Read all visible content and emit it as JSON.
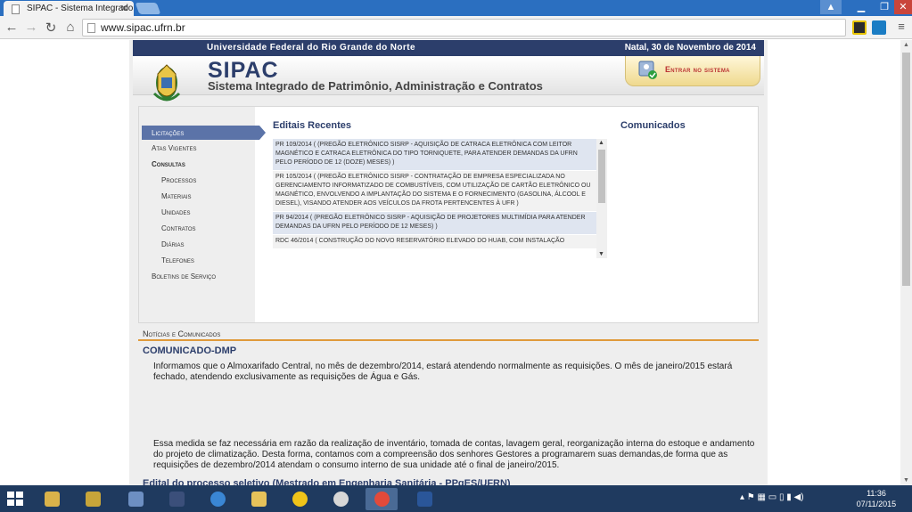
{
  "browser": {
    "tab_title": "SIPAC - Sistema Integrado",
    "url": "www.sipac.ufrn.br"
  },
  "site": {
    "university": "Universidade Federal do Rio Grande do Norte",
    "date": "Natal, 30 de Novembro de 2014",
    "title": "SIPAC",
    "subtitle": "Sistema Integrado de Patrimônio, Administração e Contratos",
    "login_label": "Entrar no sistema"
  },
  "menu": {
    "items": [
      {
        "label": "Licitações"
      },
      {
        "label": "Atas Vigentes"
      },
      {
        "label": "Consultas"
      },
      {
        "label": "Processos"
      },
      {
        "label": "Materiais"
      },
      {
        "label": "Unidades"
      },
      {
        "label": "Contratos"
      },
      {
        "label": "Diárias"
      },
      {
        "label": "Telefones"
      },
      {
        "label": "Boletins de Serviço"
      }
    ]
  },
  "editais": {
    "title": "Editais Recentes",
    "items": [
      {
        "text": "PR 109/2014 ( (PREGÃO ELETRÔNICO SISRP - AQUISIÇÃO DE CATRACA ELETRÔNICA COM LEITOR MAGNÉTICO E CATRACA ELETRÔNICA DO TIPO TORNIQUETE, PARA ATENDER DEMANDAS DA UFRN PELO PERÍODO DE 12 (DOZE) MESES) )"
      },
      {
        "text": "PR 105/2014 ( (PREGÃO ELETRÔNICO SISRP - CONTRATAÇÃO DE EMPRESA ESPECIALIZADA NO GERENCIAMENTO INFORMATIZADO DE COMBUSTÍVEIS, COM UTILIZAÇÃO DE CARTÃO ELETRÔNICO OU MAGNÉTICO, ENVOLVENDO A IMPLANTAÇÃO DO SISTEMA E O FORNECIMENTO (GASOLINA, ÁLCOOL E DIESEL), VISANDO ATENDER AOS VEÍCULOS DA FROTA PERTENCENTES À UFR )"
      },
      {
        "text": "PR 94/2014 ( (PREGÃO ELETRÔNICO SISRP - AQUISIÇÃO DE PROJETORES MULTIMÍDIA PARA ATENDER DEMANDAS DA UFRN PELO PERÍODO DE 12 MESES) )"
      },
      {
        "text": "RDC 46/2014 ( CONSTRUÇÃO DO NOVO RESERVATÓRIO ELEVADO DO HUAB, COM INSTALAÇÃO"
      }
    ]
  },
  "comunicados": {
    "title": "Comunicados"
  },
  "noticias": {
    "section_label": "Notícias e Comunicados",
    "title": "COMUNICADO-DMP",
    "p1": "Informamos que o Almoxarifado Central, no mês de dezembro/2014, estará atendendo normalmente as requisições. O mês de janeiro/2015 estará fechado, atendendo exclusivamente as requisições de Água e Gás.",
    "p2": "Essa medida se faz necessária em razão da realização de inventário, tomada de contas, lavagem geral, reorganização interna do estoque e andamento do projeto de climatização. Desta forma, contamos com a compreensão dos senhores Gestores a programarem suas demandas,de forma que as requisições de dezembro/2014 atendam o consumo interno de sua unidade até o final de janeiro/2015.",
    "title2": "Edital do processo seletivo (Mestrado em Engenharia Sanitária - PPgES/UFRN)"
  },
  "taskbar": {
    "time": "11:36",
    "date": "07/11/2015"
  },
  "colors": {
    "navy": "#2c3e6b",
    "menu_active": "#5b73a8",
    "accent_line": "#e09a3a",
    "taskbar": "#1f3a5f"
  }
}
